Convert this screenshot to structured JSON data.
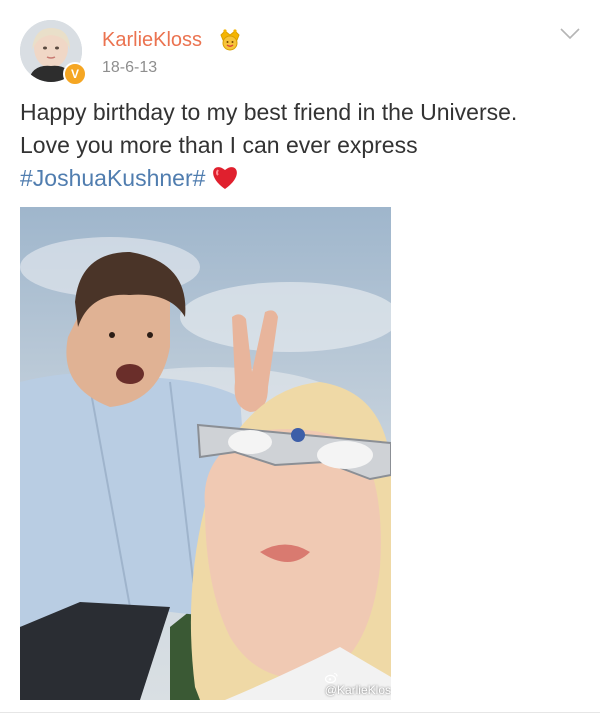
{
  "post": {
    "author": "KarlieKloss",
    "verified_badge": "V",
    "timestamp": "18-6-13",
    "text_line1": "Happy birthday to my best friend in the Universe.",
    "text_line2": "Love you more than I can ever express",
    "hashtag": "#JoshuaKushner#",
    "image_watermark": "@KarlieKlos"
  },
  "icons": {
    "crown": "crown-icon",
    "menu": "chevron-down-icon",
    "heart": "heart-icon",
    "weibo": "weibo-logo-icon"
  },
  "colors": {
    "username": "#eb7350",
    "hashtag": "#507daf",
    "badge": "#f5a623",
    "text": "#333333",
    "timestamp": "#8e8e8e"
  }
}
